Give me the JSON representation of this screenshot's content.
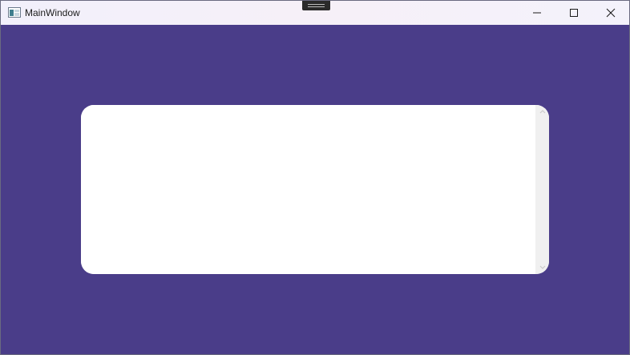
{
  "window": {
    "title": "MainWindow",
    "icon": "application-window-icon",
    "background_color": "#4a3d89"
  },
  "titlebar": {
    "controls": {
      "minimize_icon": "minimize-icon",
      "maximize_icon": "maximize-icon",
      "close_icon": "close-icon"
    }
  },
  "content": {
    "card_color": "#ffffff",
    "scrollbar": {
      "up_icon": "chevron-up-icon",
      "down_icon": "chevron-down-icon"
    }
  }
}
